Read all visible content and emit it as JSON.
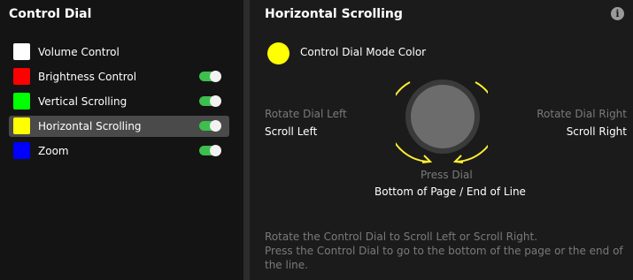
{
  "left_panel": {
    "title": "Control Dial",
    "modes": [
      {
        "label": "Volume Control",
        "color": "#ffffff",
        "toggle": null,
        "selected": false
      },
      {
        "label": "Brightness Control",
        "color": "#ff0000",
        "toggle": true,
        "selected": false
      },
      {
        "label": "Vertical Scrolling",
        "color": "#00ff00",
        "toggle": true,
        "selected": false
      },
      {
        "label": "Horizontal Scrolling",
        "color": "#ffff00",
        "toggle": true,
        "selected": true
      },
      {
        "label": "Zoom",
        "color": "#0000ff",
        "toggle": true,
        "selected": false
      }
    ]
  },
  "right_panel": {
    "title": "Horizontal Scrolling",
    "info_icon": "info-icon",
    "mode_color": {
      "label": "Control Dial Mode Color",
      "color": "#ffff00"
    },
    "rotate_left": {
      "label": "Rotate Dial Left",
      "action": "Scroll Left"
    },
    "rotate_right": {
      "label": "Rotate Dial Right",
      "action": "Scroll Right"
    },
    "press": {
      "label": "Press Dial",
      "action": "Bottom of Page / End of Line"
    },
    "description": {
      "line1": "Rotate the Control Dial to Scroll Left or Scroll Right.",
      "line2": "Press the Control Dial to go to the bottom of the page or the end of the line."
    }
  },
  "colors": {
    "accent_toggle": "#3dbf4d",
    "arrow": "#ffee33",
    "dial_outer": "#3a3a3a",
    "dial_inner": "#6c6c6c"
  }
}
